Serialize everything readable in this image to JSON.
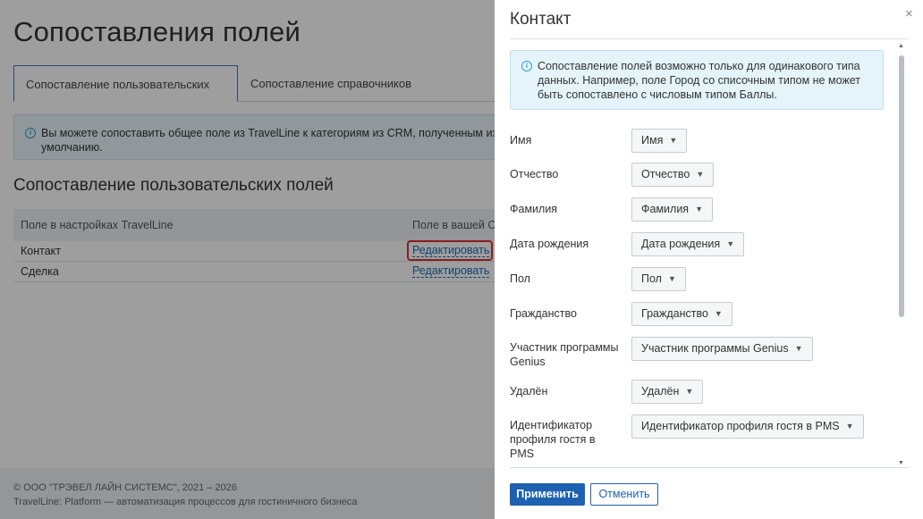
{
  "page": {
    "title": "Сопоставления полей",
    "tabs": [
      {
        "label": "Сопоставление пользовательских полей",
        "active": true
      },
      {
        "label": "Сопоставление справочников",
        "active": false
      }
    ],
    "info_line1": "Вы можете сопоставить общее поле из TravelLine к категориям из CRM, полученным из инте",
    "info_line2": "умолчанию.",
    "section_title": "Сопоставление пользовательских полей",
    "table": {
      "col1": "Поле в настройках TravelLine",
      "col2": "Поле в вашей CR",
      "rows": [
        {
          "name": "Контакт",
          "action": "Редактировать"
        },
        {
          "name": "Сделка",
          "action": "Редактировать"
        }
      ]
    },
    "footer_line1": "© ООО \"ТРЭВЕЛ ЛАЙН СИСТЕМС\", 2021 – 2026",
    "footer_line2": "TravelLine: Platform — автоматизация процессов для гостиничного бизнеса"
  },
  "panel": {
    "title": "Контакт",
    "close_glyph": "×",
    "notice": "Сопоставление полей возможно только для одинакового типа данных. Например, поле Город со списочным типом не может быть сопоставлено с числовым типом Баллы.",
    "fields": [
      {
        "label": "Имя",
        "value": "Имя"
      },
      {
        "label": "Отчество",
        "value": "Отчество"
      },
      {
        "label": "Фамилия",
        "value": "Фамилия"
      },
      {
        "label": "Дата рождения",
        "value": "Дата рождения"
      },
      {
        "label": "Пол",
        "value": "Пол"
      },
      {
        "label": "Гражданство",
        "value": "Гражданство"
      },
      {
        "label": "Участник программы Genius",
        "value": "Участник программы Genius"
      },
      {
        "label": "Удалён",
        "value": "Удалён"
      },
      {
        "label": "Идентификатор профиля гостя в PMS",
        "value": "Идентификатор профиля гостя в PMS"
      }
    ],
    "apply_label": "Применить",
    "cancel_label": "Отменить"
  },
  "icons": {
    "info": "info-icon",
    "chevron": "chevron-down-icon",
    "close": "close-icon"
  },
  "colors": {
    "primary": "#1d61b0",
    "highlight": "#e03030",
    "notice_bg": "#e4f4fa"
  }
}
